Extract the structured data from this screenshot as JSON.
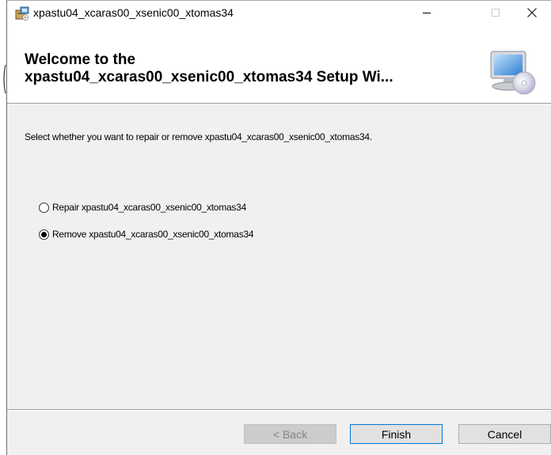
{
  "window": {
    "title": "xpastu04_xcaras00_xsenic00_xtomas34",
    "icons": {
      "app": "installer-package-icon",
      "minimize": "minimize-icon",
      "maximize": "maximize-icon",
      "close": "close-icon"
    }
  },
  "header": {
    "title_line1": "Welcome to the",
    "title_line2": "xpastu04_xcaras00_xsenic00_xtomas34 Setup Wi...",
    "graphic": "computer-cd-icon"
  },
  "body": {
    "instruction": "Select whether you want to repair or remove xpastu04_xcaras00_xsenic00_xtomas34.",
    "options": [
      {
        "label": "Repair xpastu04_xcaras00_xsenic00_xtomas34",
        "selected": false
      },
      {
        "label": "Remove xpastu04_xcaras00_xsenic00_xtomas34",
        "selected": true
      }
    ]
  },
  "footer": {
    "back_label": "< Back",
    "finish_label": "Finish",
    "cancel_label": "Cancel"
  },
  "colors": {
    "window_bg": "#f0f0f0",
    "header_bg": "#ffffff",
    "focus_border": "#0078d7",
    "disabled_text": "#838383"
  }
}
